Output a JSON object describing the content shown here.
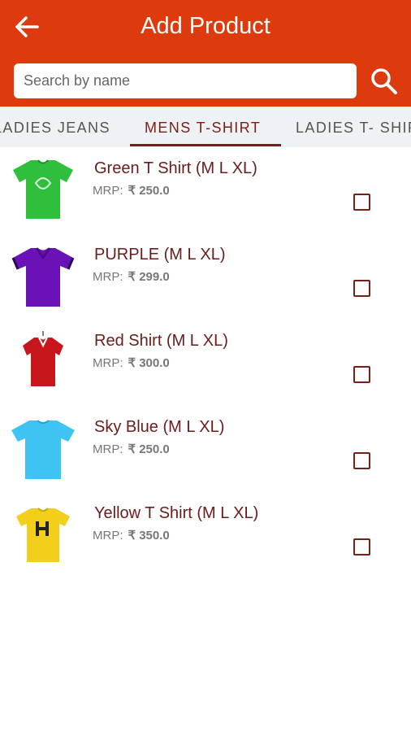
{
  "header": {
    "title": "Add Product",
    "back_icon": "arrow-left-icon",
    "bg_color": "#dd3b0e"
  },
  "search": {
    "placeholder": "Search by name",
    "value": "",
    "icon": "search-icon"
  },
  "tabs": [
    {
      "label": "LADIES JEANS",
      "active": false
    },
    {
      "label": "MENS T-SHIRT",
      "active": true
    },
    {
      "label": "LADIES T- SHIRT",
      "active": false
    }
  ],
  "products": [
    {
      "name": "Green T Shirt  (M L XL)",
      "mrp_label": "MRP:",
      "price": "₹ 250.0",
      "color": "#2fbf3c",
      "checked": false
    },
    {
      "name": "PURPLE  (M L XL)",
      "mrp_label": "MRP:",
      "price": "₹ 299.0",
      "color": "#6a12b8",
      "checked": false
    },
    {
      "name": "Red Shirt  (M L XL)",
      "mrp_label": "MRP:",
      "price": "₹ 300.0",
      "color": "#c8161d",
      "checked": false
    },
    {
      "name": "Sky Blue  (M L XL)",
      "mrp_label": "MRP:",
      "price": "₹ 250.0",
      "color": "#3ec3f2",
      "checked": false
    },
    {
      "name": "Yellow T Shirt  (M L XL)",
      "mrp_label": "MRP:",
      "price": "₹ 350.0",
      "color": "#f1cf1b",
      "checked": false
    }
  ]
}
